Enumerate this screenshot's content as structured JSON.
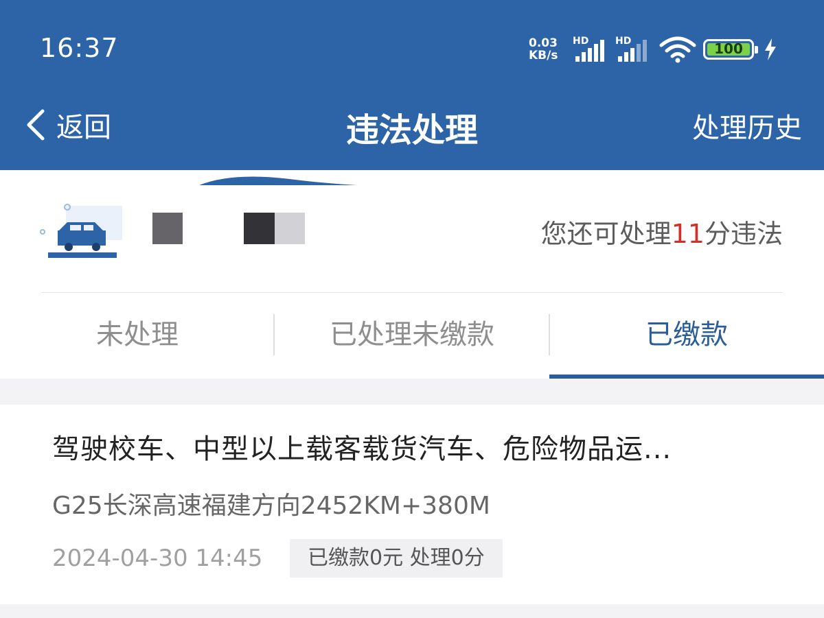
{
  "status_bar": {
    "time": "16:37",
    "net_speed_value": "0.03",
    "net_speed_unit": "KB/s",
    "signal1_label": "HD",
    "signal2_label": "HD",
    "battery_level": "100",
    "icons": [
      "wifi-icon",
      "battery-icon",
      "charging-bolt-icon"
    ]
  },
  "nav": {
    "back_label": "返回",
    "title": "违法处理",
    "history_label": "处理历史",
    "bar_color": "#2d64a8"
  },
  "summary": {
    "points_prefix": "您还可处理",
    "points_value": "11",
    "points_suffix": "分违法",
    "points_color": "#d0302a"
  },
  "tabs": [
    {
      "label": "未处理",
      "active": false
    },
    {
      "label": "已处理未缴款",
      "active": false
    },
    {
      "label": "已缴款",
      "active": true
    }
  ],
  "records": [
    {
      "title": "驾驶校车、中型以上载客载货汽车、危险物品运...",
      "location": "G25长深高速福建方向2452KM+380M",
      "datetime": "2024-04-30 14:45",
      "badge": "已缴款0元 处理0分"
    }
  ],
  "accent_color": "#2b5d99"
}
